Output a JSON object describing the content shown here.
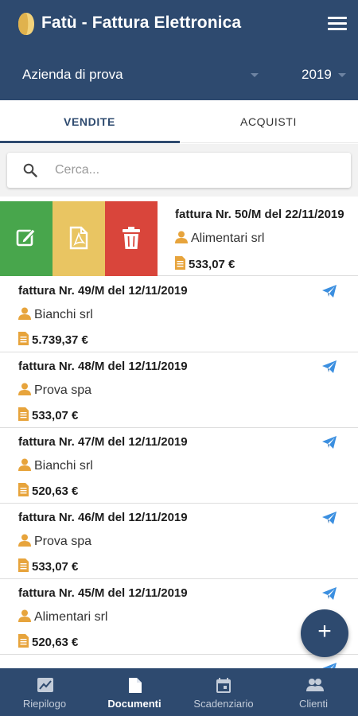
{
  "header": {
    "app_title": "Fatù - Fattura Elettronica",
    "company": "Azienda di prova",
    "year": "2019"
  },
  "tabs": [
    {
      "label": "VENDITE",
      "active": true
    },
    {
      "label": "ACQUISTI",
      "active": false
    }
  ],
  "search": {
    "placeholder": "Cerca...",
    "value": ""
  },
  "swiped_invoice": {
    "title": "fattura Nr. 50/M del 22/11/2019",
    "client": "Alimentari srl",
    "amount": "533,07 €",
    "actions": [
      "edit-icon",
      "pdf-icon",
      "trash-icon"
    ]
  },
  "invoices": [
    {
      "title": "fattura Nr. 49/M del 12/11/2019",
      "client": "Bianchi srl",
      "amount": "5.739,37 €"
    },
    {
      "title": "fattura Nr. 48/M del 12/11/2019",
      "client": "Prova spa",
      "amount": "533,07 €"
    },
    {
      "title": "fattura Nr. 47/M del 12/11/2019",
      "client": "Bianchi srl",
      "amount": "520,63 €"
    },
    {
      "title": "fattura Nr. 46/M del 12/11/2019",
      "client": "Prova spa",
      "amount": "533,07 €"
    },
    {
      "title": "fattura Nr. 45/M del 12/11/2019",
      "client": "Alimentari srl",
      "amount": "520,63 €"
    }
  ],
  "fab": {
    "label": "+"
  },
  "bottom_nav": [
    {
      "label": "Riepilogo",
      "icon": "chart-icon",
      "active": false
    },
    {
      "label": "Documenti",
      "icon": "document-icon",
      "active": true
    },
    {
      "label": "Scadenziario",
      "icon": "calendar-icon",
      "active": false
    },
    {
      "label": "Clienti",
      "icon": "people-icon",
      "active": false
    }
  ],
  "colors": {
    "primary": "#2e4a6f",
    "edit": "#48a64c",
    "pdf": "#e9c562",
    "delete": "#d9453b",
    "accent_icon": "#e7a43c",
    "send_icon": "#3b8fe0"
  }
}
